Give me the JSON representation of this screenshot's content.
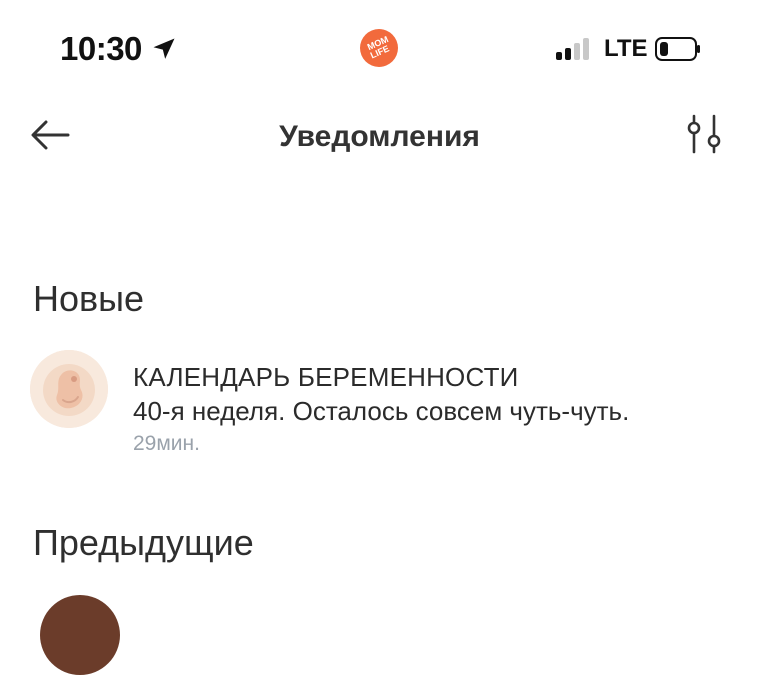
{
  "status_bar": {
    "time": "10:30",
    "app_badge_line1": "MOM",
    "app_badge_line2": "LIFE",
    "carrier": "LTE",
    "icons": [
      "location-arrow-icon",
      "signal-icon",
      "battery-icon"
    ]
  },
  "header": {
    "title": "Уведомления",
    "icons": [
      "arrow-left-icon",
      "sliders-icon"
    ]
  },
  "sections": {
    "new_title": "Новые",
    "previous_title": "Предыдущие"
  },
  "notifications": [
    {
      "category": "КАЛЕНДАРЬ БЕРЕМЕННОСТИ",
      "message": "40-я неделя. Осталось совсем чуть-чуть.",
      "time": "29мин.",
      "icon": "embryo-icon"
    }
  ],
  "colors": {
    "accent": "#f26a3c",
    "text": "#2b2b2b",
    "muted": "#9aa2ab",
    "avatar_bg": "#f6e6d9"
  }
}
